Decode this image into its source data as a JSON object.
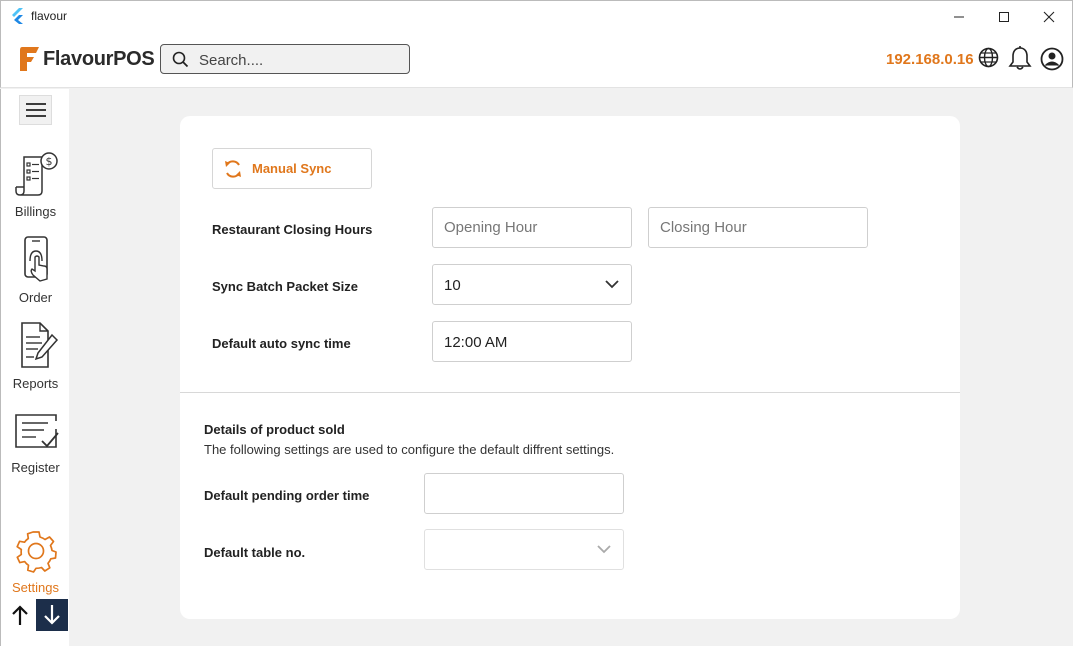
{
  "window": {
    "title": "flavour"
  },
  "header": {
    "logo_text": "FlavourPOS",
    "search_placeholder": "Search....",
    "ip_address": "192.168.0.16"
  },
  "sidebar": {
    "items": [
      {
        "label": "Billings",
        "icon": "billing-icon"
      },
      {
        "label": "Order",
        "icon": "mobile-order-icon"
      },
      {
        "label": "Reports",
        "icon": "report-icon"
      },
      {
        "label": "Register",
        "icon": "register-icon"
      },
      {
        "label": "Settings",
        "icon": "gear-icon",
        "active": true
      }
    ]
  },
  "settings": {
    "manual_sync_label": "Manual Sync",
    "closing_hours_label": "Restaurant Closing Hours",
    "opening_hour_placeholder": "Opening Hour",
    "closing_hour_placeholder": "Closing Hour",
    "batch_size_label": "Sync Batch Packet Size",
    "batch_size_value": "10",
    "auto_sync_label": "Default auto sync time",
    "auto_sync_value": "12:00 AM",
    "section_title": "Details of product sold",
    "section_desc": "The following settings are used to configure the default diffrent settings.",
    "pending_order_label": "Default pending order time",
    "pending_order_value": "",
    "table_no_label": "Default table no.",
    "table_no_value": ""
  },
  "colors": {
    "accent": "#e0771c",
    "navy": "#1c2e4a"
  }
}
